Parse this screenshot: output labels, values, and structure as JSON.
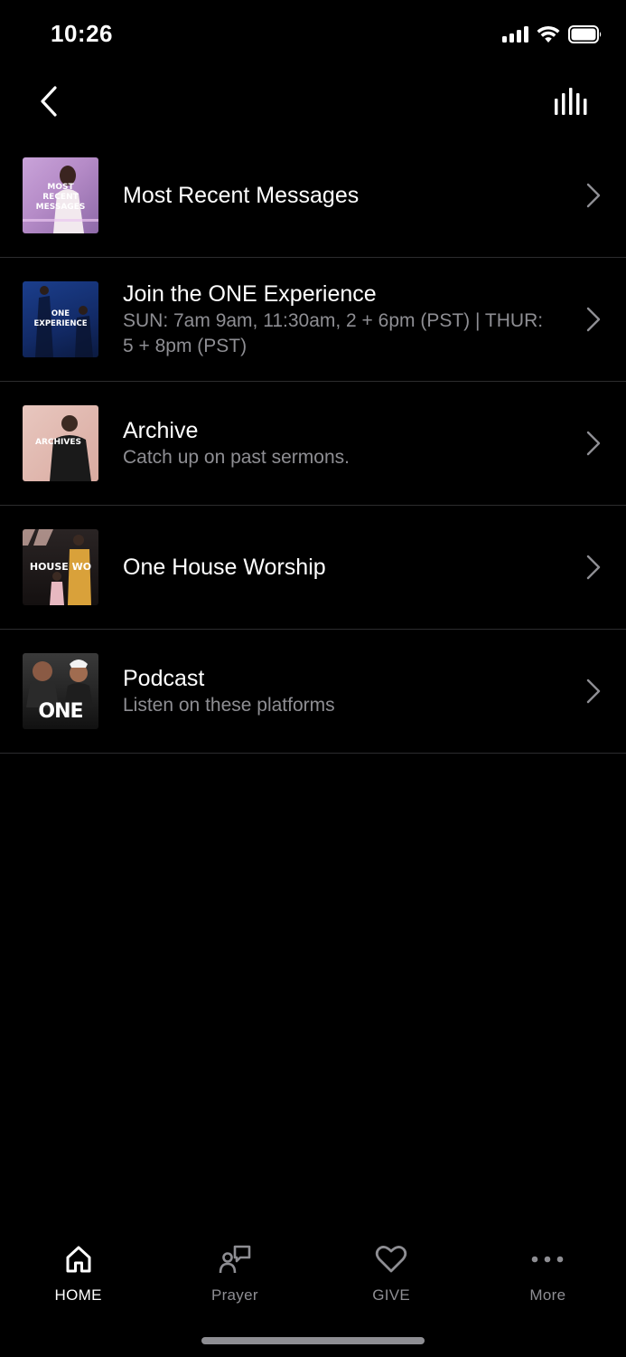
{
  "status_bar": {
    "time": "10:26"
  },
  "nav": {
    "back_icon": "chevron-left-icon",
    "equalizer_icon": "equalizer-icon"
  },
  "list": {
    "items": [
      {
        "title": "Most Recent Messages",
        "subtitle": "",
        "thumb_text": "MOST RECENT MESSAGES"
      },
      {
        "title": "Join the ONE Experience",
        "subtitle": "SUN: 7am 9am, 11:30am, 2 + 6pm (PST) | THUR: 5 + 8pm (PST)",
        "thumb_text": "ONE EXPERIENCE"
      },
      {
        "title": "Archive",
        "subtitle": "Catch up on past sermons.",
        "thumb_text": "ARCHIVES"
      },
      {
        "title": "One House Worship",
        "subtitle": "",
        "thumb_text": "HOUSE WO"
      },
      {
        "title": "Podcast",
        "subtitle": "Listen on these platforms",
        "thumb_text": "ONE"
      }
    ]
  },
  "tab_bar": {
    "tabs": [
      {
        "label": "HOME",
        "icon": "home-icon",
        "active": true
      },
      {
        "label": "Prayer",
        "icon": "prayer-icon",
        "active": false
      },
      {
        "label": "GIVE",
        "icon": "heart-icon",
        "active": false
      },
      {
        "label": "More",
        "icon": "more-dots-icon",
        "active": false
      }
    ]
  },
  "colors": {
    "background": "#000000",
    "text_primary": "#ffffff",
    "text_secondary": "#8e8e93",
    "divider": "#2c2c2e"
  }
}
